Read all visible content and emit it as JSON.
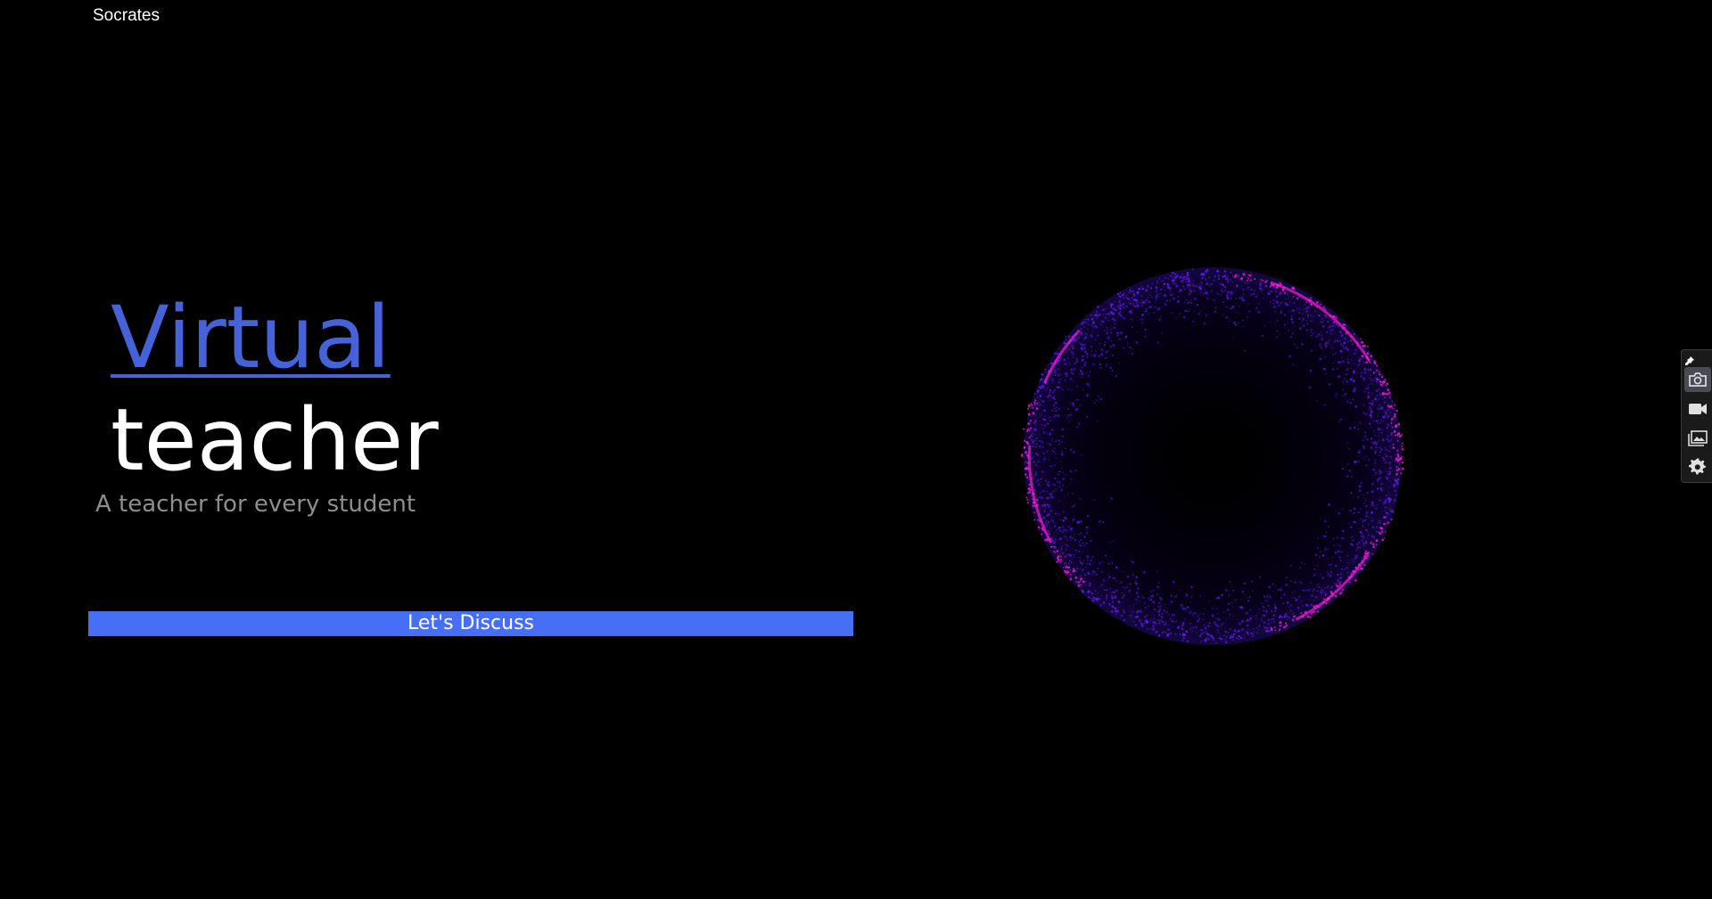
{
  "brand": {
    "name": "Socrates"
  },
  "hero": {
    "title_accent": "Virtual",
    "title_rest": "teacher",
    "subtitle": "A teacher for every student",
    "accent_color": "#4562d8"
  },
  "cta": {
    "label": "Let's Discuss",
    "color": "#476ff5"
  },
  "orb": {
    "icon": "particle-sphere",
    "colors": [
      "#6a1bff",
      "#ff1ad9"
    ]
  },
  "toolbar": {
    "items": [
      {
        "icon": "pin-icon"
      },
      {
        "icon": "camera-icon",
        "active": true
      },
      {
        "icon": "video-icon"
      },
      {
        "icon": "gallery-icon"
      },
      {
        "icon": "gear-icon"
      }
    ]
  }
}
